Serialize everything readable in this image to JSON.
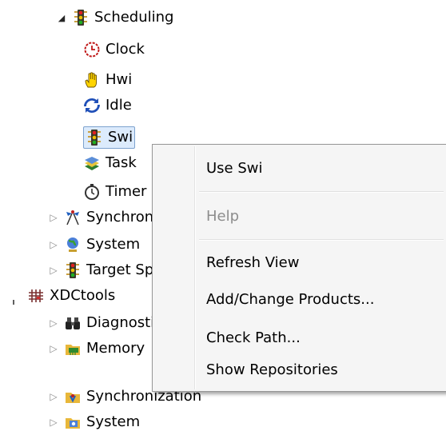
{
  "tree": {
    "items": [
      {
        "label": "Scheduling",
        "icon": "traffic-light-icon"
      },
      {
        "label": "Clock",
        "icon": "clock-icon"
      },
      {
        "label": "Hwi",
        "icon": "hand-icon"
      },
      {
        "label": "Idle",
        "icon": "cycle-arrows-icon"
      },
      {
        "label": "Swi",
        "icon": "traffic-light-icon"
      },
      {
        "label": "Task",
        "icon": "stack-icon"
      },
      {
        "label": "Timer",
        "icon": "stopwatch-icon"
      },
      {
        "label": "Synchronization",
        "icon": "flags-icon"
      },
      {
        "label": "System",
        "icon": "globe-icon"
      },
      {
        "label": "Target Specific",
        "icon": "traffic-light-icon"
      },
      {
        "label": "XDCtools",
        "icon": "grid-icon"
      },
      {
        "label": "Diagnostics",
        "icon": "binoculars-icon"
      },
      {
        "label": "Memory",
        "icon": "memory-chip-icon"
      },
      {
        "label": "Synchronization",
        "icon": "sync-folder-icon"
      },
      {
        "label": "System",
        "icon": "system-folder-icon"
      }
    ]
  },
  "context_menu": {
    "use": "Use Swi",
    "help": "Help",
    "refresh": "Refresh View",
    "add_change": "Add/Change Products...",
    "check_path": "Check Path...",
    "show_repos": "Show Repositories"
  },
  "colors": {
    "selection_bg": "#dcebfc",
    "selection_border": "#7da2ce",
    "menu_bg": "#f5f5f5",
    "disabled_text": "#8d8d8d"
  }
}
